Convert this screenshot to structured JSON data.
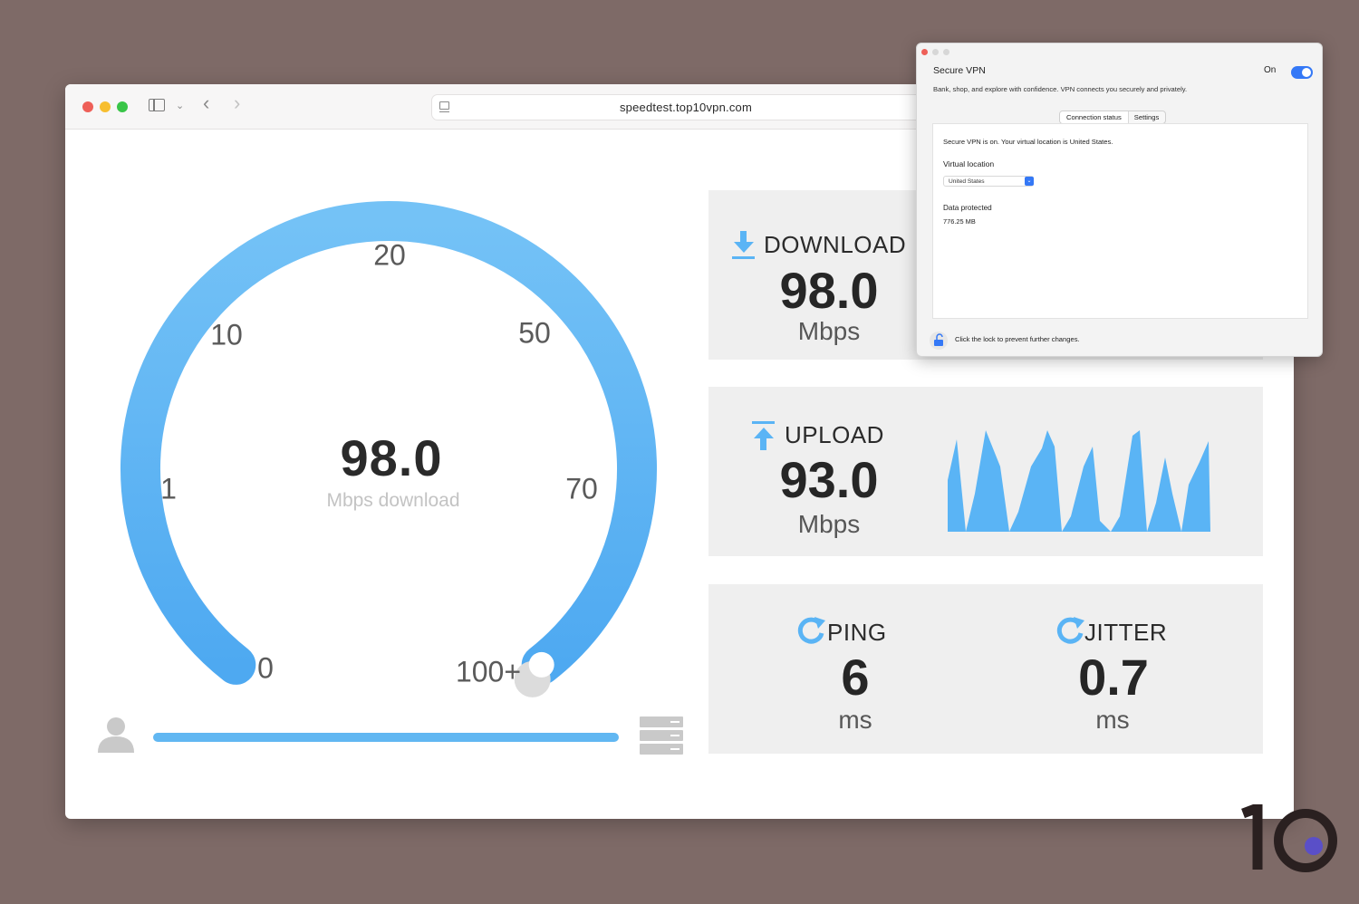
{
  "browser": {
    "url": "speedtest.top10vpn.com"
  },
  "gauge": {
    "value": "98.0",
    "unit_label": "Mbps download",
    "scale_labels": [
      "0",
      "1",
      "10",
      "20",
      "50",
      "70",
      "100+"
    ],
    "fill_fraction": 1.0
  },
  "download": {
    "title": "DOWNLOAD",
    "value": "98.0",
    "unit": "Mbps"
  },
  "upload": {
    "title": "UPLOAD",
    "value": "93.0",
    "unit": "Mbps"
  },
  "ping": {
    "title": "PING",
    "value": "6",
    "unit": "ms"
  },
  "jitter": {
    "title": "JITTER",
    "value": "0.7",
    "unit": "ms"
  },
  "vpn_window": {
    "title": "Secure VPN",
    "description": "Bank, shop, and explore with confidence. VPN connects you securely and privately.",
    "toggle_label": "On",
    "toggle_state": "on",
    "tabs": [
      "Connection status",
      "Settings"
    ],
    "status_text": "Secure VPN is on. Your virtual location is United States.",
    "virtual_location_label": "Virtual location",
    "virtual_location_value": "United States",
    "data_protected_label": "Data protected",
    "data_protected_value": "776.25 MB",
    "lock_text": "Click the lock to prevent further changes."
  },
  "colors": {
    "accent_blue": "#5ab4f5",
    "panel_bg": "#efefef",
    "background": "#7e6a67"
  }
}
